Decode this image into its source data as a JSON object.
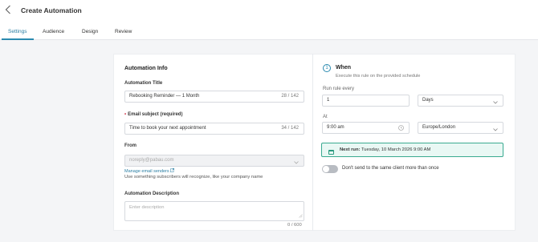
{
  "header": {
    "title": "Create Automation"
  },
  "tabs": [
    {
      "label": "Settings"
    },
    {
      "label": "Audience"
    },
    {
      "label": "Design"
    },
    {
      "label": "Review"
    }
  ],
  "info": {
    "heading": "Automation Info",
    "title_label": "Automation Title",
    "title_value": "Rebooking Reminder — 1 Month",
    "title_count": "28 / 142",
    "subject_label": "Email subject (required)",
    "subject_value": "Time to book your next appointment",
    "subject_count": "34 / 142",
    "from_label": "From",
    "from_value": "noreply@pabau.com",
    "manage_link": "Manage email senders",
    "from_hint": "Use something subscribers will recognize, like your company name",
    "desc_label": "Automation Description",
    "desc_placeholder": "Enter description",
    "desc_count": "0 / 600"
  },
  "when": {
    "step": "1",
    "heading": "When",
    "subtitle": "Execute this rule on the provided schedule",
    "run_label": "Run rule every",
    "run_value": "1",
    "unit_value": "Days",
    "at_label": "At",
    "time_value": "9:00 am",
    "timezone_value": "Europe/London",
    "next_run_label": "Next run:",
    "next_run_value": "Tuesday, 10 March 2026 9:00 AM",
    "toggle_label": "Don't send to the same client more than once",
    "toggle_on": false
  },
  "colors": {
    "accent": "#2a8ab0",
    "success_border": "#3aaa90",
    "success_bg": "#e9f8f4"
  }
}
